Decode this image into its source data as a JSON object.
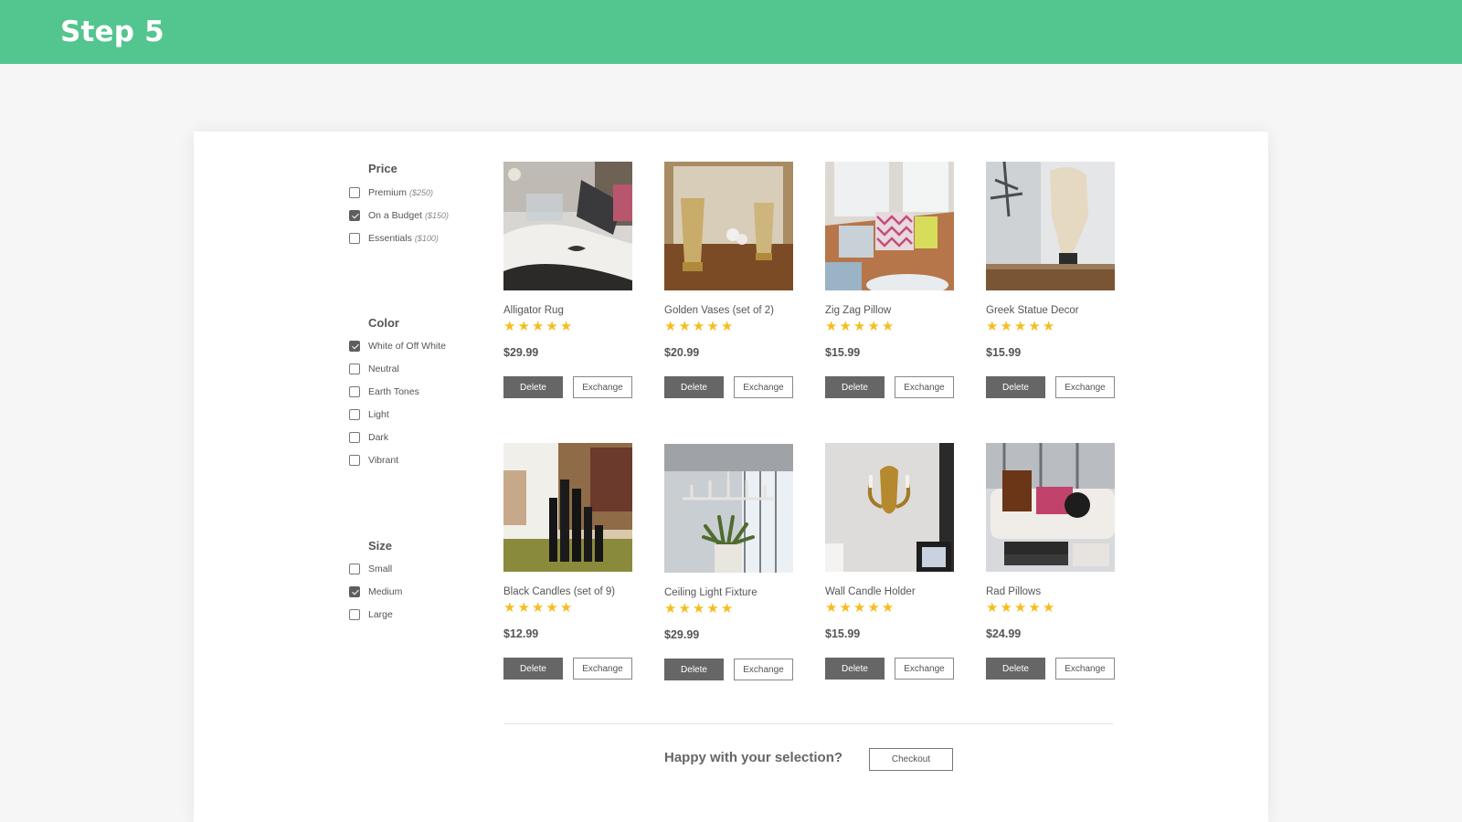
{
  "header": {
    "title": "Step 5"
  },
  "colors": {
    "brand": "#53c58f",
    "star": "#f5bd1f",
    "button_dark": "#666666"
  },
  "filters": {
    "price": {
      "title": "Price",
      "options": [
        {
          "label": "Premium",
          "note": "($250)",
          "checked": false
        },
        {
          "label": "On a Budget",
          "note": "($150)",
          "checked": true
        },
        {
          "label": "Essentials",
          "note": "($100)",
          "checked": false
        }
      ]
    },
    "color": {
      "title": "Color",
      "options": [
        {
          "label": "White of Off White",
          "checked": true
        },
        {
          "label": "Neutral",
          "checked": false
        },
        {
          "label": "Earth Tones",
          "checked": false
        },
        {
          "label": "Light",
          "checked": false
        },
        {
          "label": "Dark",
          "checked": false
        },
        {
          "label": "Vibrant",
          "checked": false
        }
      ]
    },
    "size": {
      "title": "Size",
      "options": [
        {
          "label": "Small",
          "checked": false
        },
        {
          "label": "Medium",
          "checked": true
        },
        {
          "label": "Large",
          "checked": false
        }
      ]
    }
  },
  "products": [
    {
      "name": "Alligator Rug",
      "rating": 5,
      "price": "$29.99"
    },
    {
      "name": "Golden Vases (set of 2)",
      "rating": 5,
      "price": "$20.99"
    },
    {
      "name": "Zig Zag Pillow",
      "rating": 5,
      "price": "$15.99"
    },
    {
      "name": "Greek Statue Decor",
      "rating": 5,
      "price": "$15.99"
    },
    {
      "name": "Black Candles (set of 9)",
      "rating": 5,
      "price": "$12.99"
    },
    {
      "name": "Ceiling Light Fixture",
      "rating": 5,
      "price": "$29.99"
    },
    {
      "name": "Wall Candle Holder",
      "rating": 5,
      "price": "$15.99"
    },
    {
      "name": "Rad Pillows",
      "rating": 5,
      "price": "$24.99"
    }
  ],
  "buttons": {
    "delete": "Delete",
    "exchange": "Exchange"
  },
  "footer": {
    "question": "Happy with your selection?",
    "checkout": "Checkout"
  }
}
